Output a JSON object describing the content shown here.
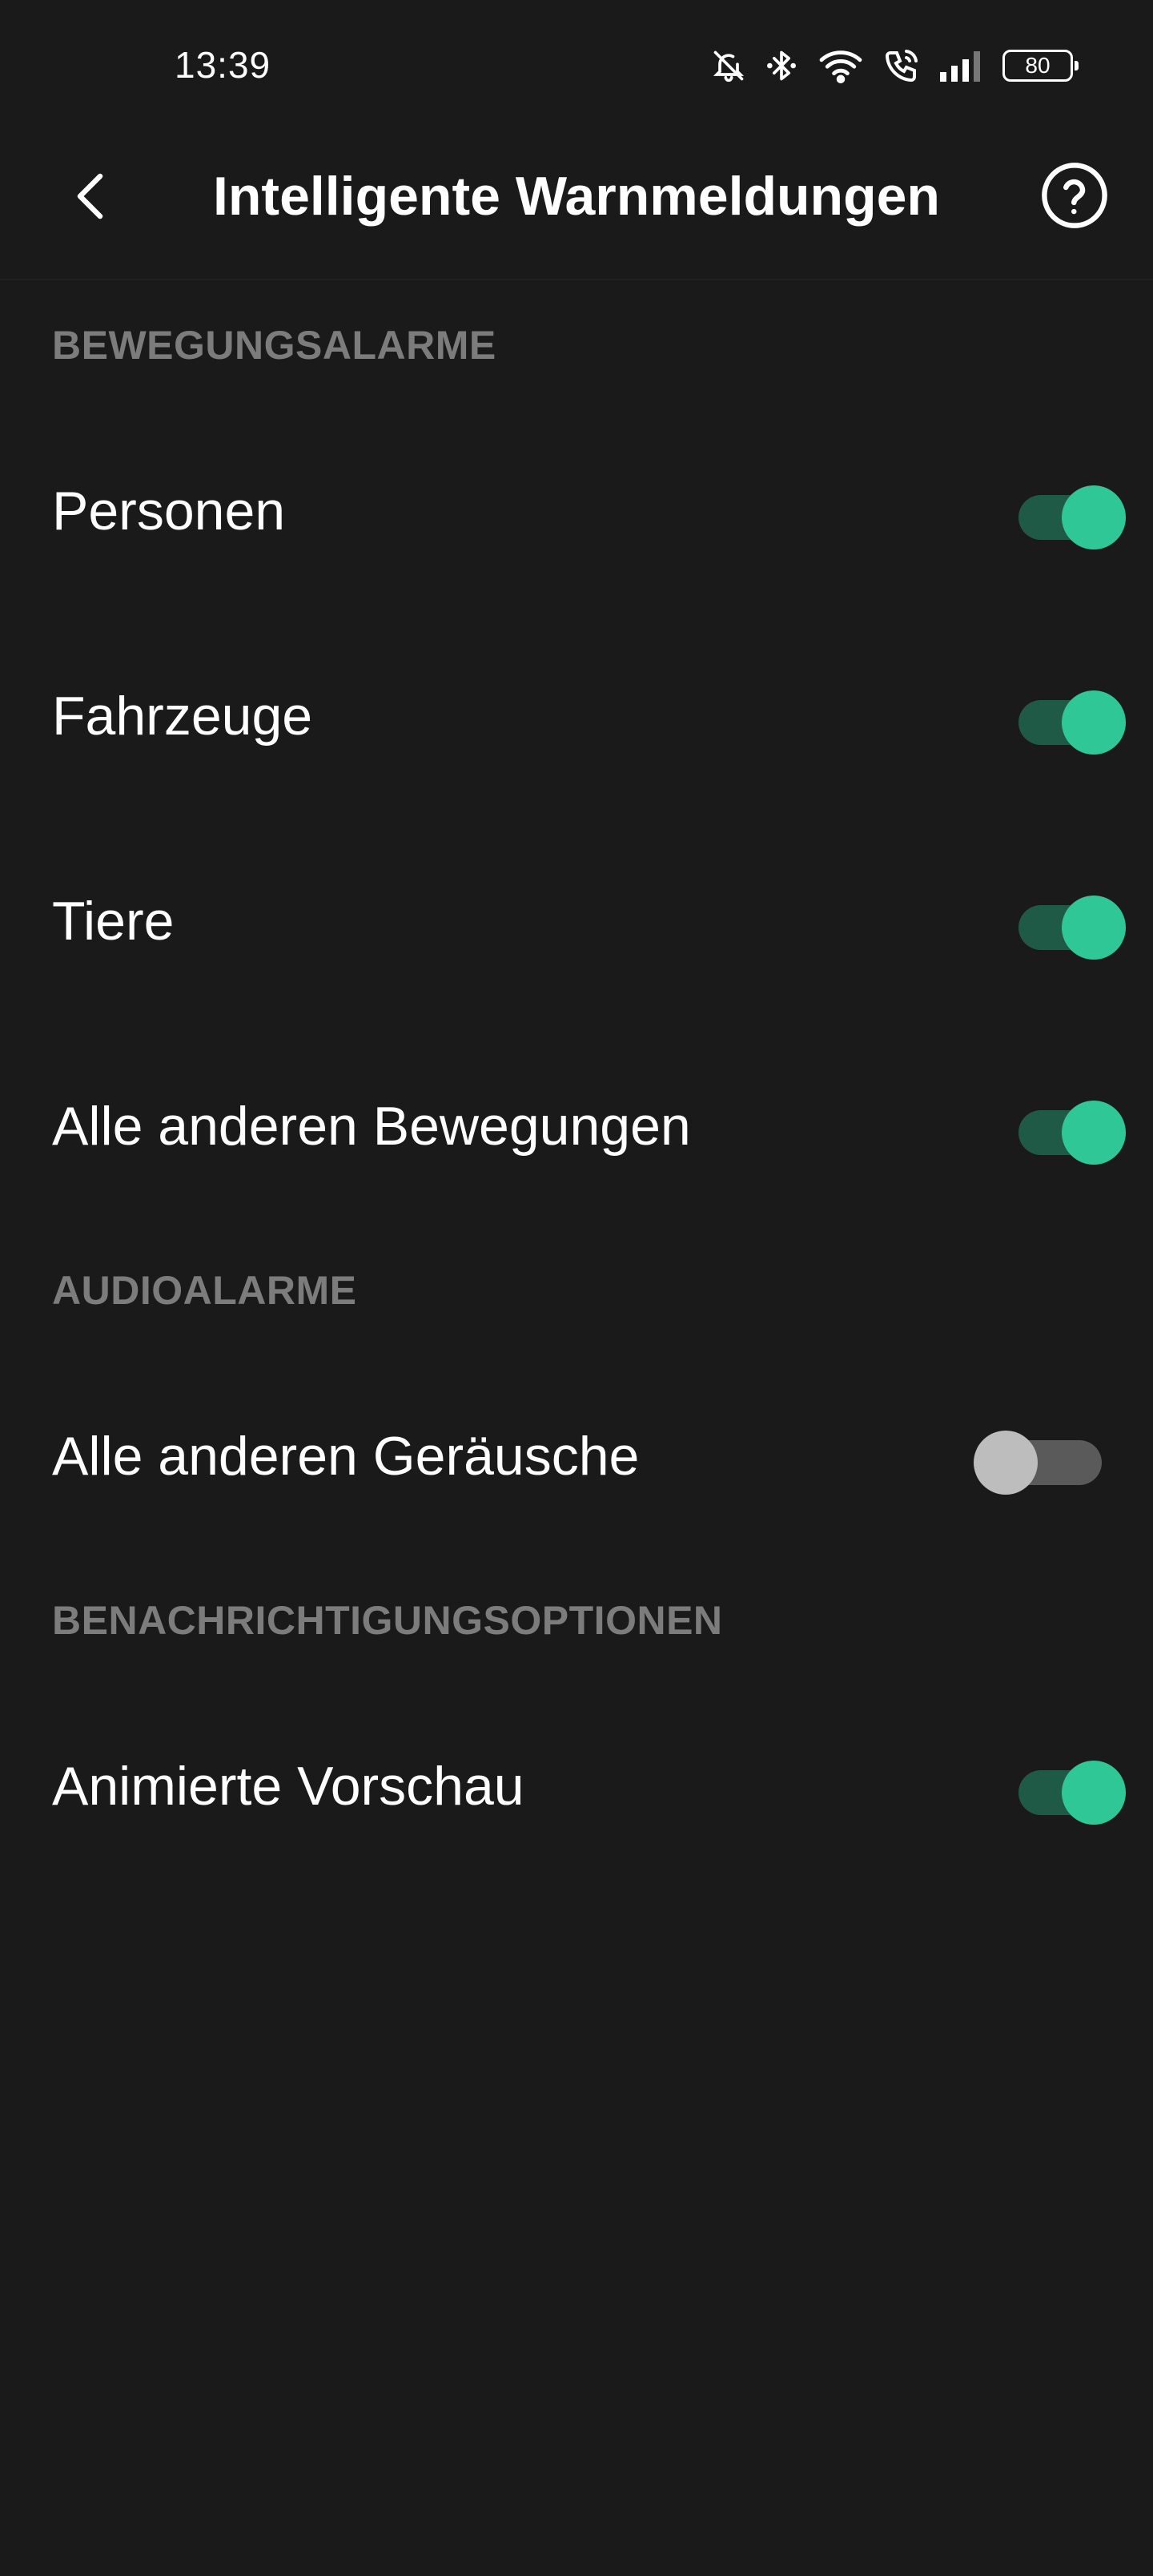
{
  "status_bar": {
    "time": "13:39",
    "icons": [
      "bell-muted-icon",
      "bluetooth-icon",
      "wifi-icon",
      "wifi-call-icon",
      "signal-icon",
      "battery-icon"
    ],
    "battery_level": "80"
  },
  "header": {
    "title": "Intelligente Warnmeldungen",
    "back_icon": "chevron-left-icon",
    "help_icon": "help-circle-icon"
  },
  "sections": {
    "motion": {
      "title": "BEWEGUNGSALARME",
      "items": [
        {
          "label": "Personen",
          "enabled": true
        },
        {
          "label": "Fahrzeuge",
          "enabled": true
        },
        {
          "label": "Tiere",
          "enabled": true
        },
        {
          "label": "Alle anderen Bewegungen",
          "enabled": true
        }
      ]
    },
    "audio": {
      "title": "AUDIOALARME",
      "items": [
        {
          "label": "Alle anderen Geräusche",
          "enabled": false
        }
      ]
    },
    "notifications": {
      "title": "BENACHRICHTIGUNGSOPTIONEN",
      "items": [
        {
          "label": "Animierte Vorschau",
          "enabled": true
        }
      ]
    }
  },
  "colors": {
    "background": "#1a1a1a",
    "accent": "#2fc795",
    "accent_track": "#1e5a46",
    "section_header": "#7c7c7c",
    "toggle_off_knob": "#bdbdbd",
    "toggle_off_track": "#5a5a5a"
  }
}
